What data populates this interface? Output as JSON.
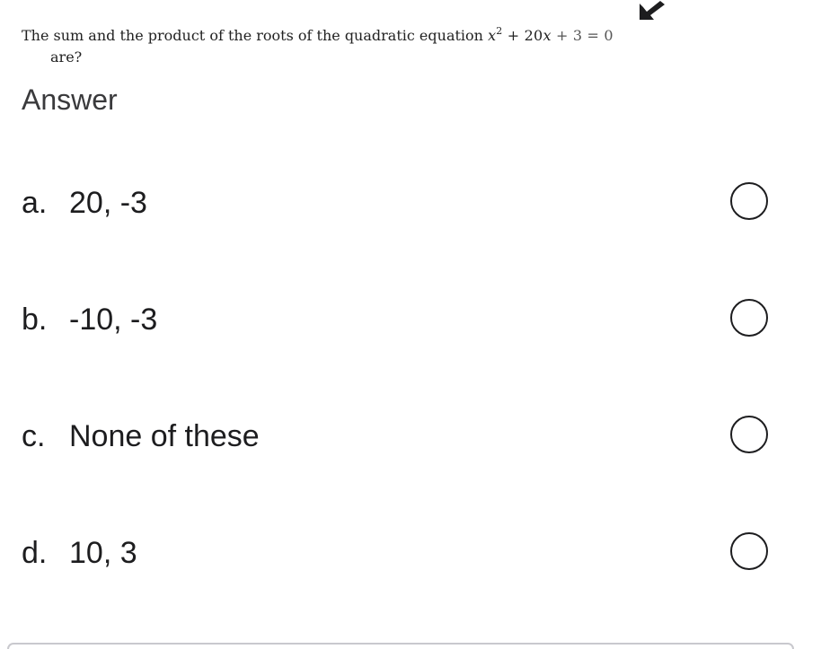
{
  "question": {
    "text_line1": "The sum and the product of the roots of the quadratic equation",
    "equation": {
      "var": "x",
      "power": "2",
      "rest_a": " + 20",
      "var2": "x",
      "rest_b": " + 3",
      "equals": " = 0"
    },
    "text_line2": "are?"
  },
  "answer_label": "Answer",
  "options": [
    {
      "letter": "a.",
      "text": "20, -3",
      "selected": false
    },
    {
      "letter": "b.",
      "text": "-10, -3",
      "selected": false
    },
    {
      "letter": "c.",
      "text": "None of these",
      "selected": false
    },
    {
      "letter": "d.",
      "text": "10, 3",
      "selected": false
    }
  ],
  "icons": {
    "cursor": "arrow-cursor-icon",
    "radio": "radio-circle-icon"
  },
  "colors": {
    "text": "#1d1d1f",
    "answer_label": "#3a3a3c",
    "radio_border": "#1d1d1f"
  }
}
